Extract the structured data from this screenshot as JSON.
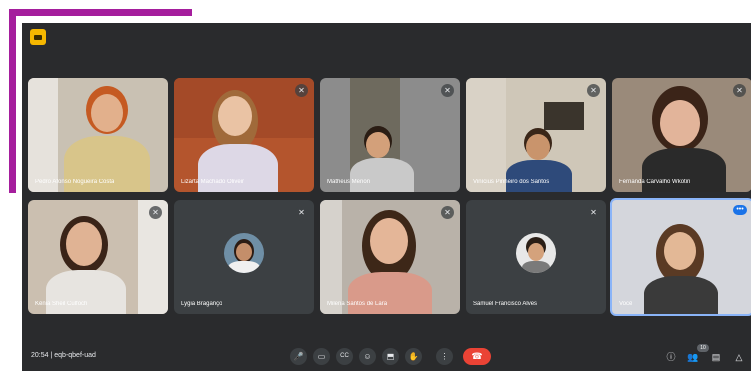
{
  "meeting": {
    "time": "20:54",
    "separator": "|",
    "code": "eqb-qbef-uad"
  },
  "participants": [
    {
      "name": "Pedro Afonso Nogueira Costa"
    },
    {
      "name": "Lizarta Machado Oliveir"
    },
    {
      "name": "Matheus Menon"
    },
    {
      "name": "Vinícius Pinheiro dos Santos"
    },
    {
      "name": "Fernanda Carvalho Wkotin"
    },
    {
      "name": "Kênia Sheil Culfoch"
    },
    {
      "name": "Lygia Braganço"
    },
    {
      "name": "Milena Santos de Lara"
    },
    {
      "name": "Samuel Francisco Alves"
    },
    {
      "name": "Você"
    }
  ],
  "self_tile": {
    "badge": "•••"
  },
  "controls": {
    "mic": "🎤",
    "camera": "▭",
    "captions": "CC",
    "emoji": "☺",
    "present": "⬒",
    "raise_hand": "✋",
    "more": "⋮",
    "hangup": "☎"
  },
  "right_panel": {
    "info": "ⓘ",
    "people": "👥",
    "chat": "▤",
    "activities": "△",
    "people_count": "10"
  },
  "colors": {
    "accent_bracket": "#a51e9d",
    "background": "#2a2b2d",
    "hangup": "#ea4335",
    "logo": "#f5b700",
    "self_border": "#8ab4f8"
  }
}
